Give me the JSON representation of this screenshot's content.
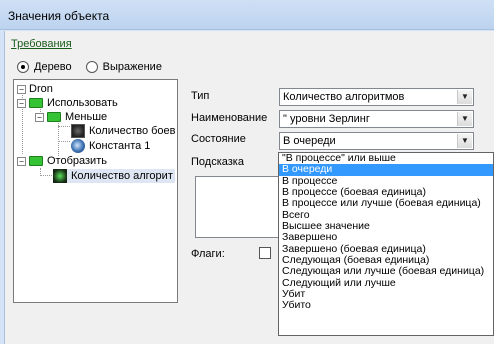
{
  "window": {
    "title": "Значения объекта"
  },
  "tab": {
    "label": "Требования"
  },
  "view_mode": {
    "tree_label": "Дерево",
    "expression_label": "Выражение",
    "selected": "tree"
  },
  "tree": {
    "nodes": [
      {
        "label": "Dron",
        "toggle": "−"
      },
      {
        "label": "Использовать",
        "toggle": "−"
      },
      {
        "label": "Меньше",
        "toggle": "−"
      },
      {
        "label": "Количество боев"
      },
      {
        "label": "Константа 1"
      },
      {
        "label": "Отобразить",
        "toggle": "−"
      },
      {
        "label": "Количество алгорит"
      }
    ]
  },
  "form": {
    "type_label": "Тип",
    "type_value": "Количество алгоритмов",
    "name_label": "Наименование",
    "name_value": "\" уровни Зерлинг",
    "state_label": "Состояние",
    "state_value": "В очереди",
    "hint_label": "Подсказка",
    "flags_label": "Флаги:"
  },
  "state_dropdown": {
    "options": [
      "\"В процессе\" или выше",
      "В очереди",
      "В процессе",
      "В процессе (боевая единица)",
      "В процессе или лучше (боевая единица)",
      "Всего",
      "Высшее значение",
      "Завершено",
      "Завершено (боевая единица)",
      "Следующая (боевая единица)",
      "Следующая или лучше (боевая единица)",
      "Следующий или лучше",
      "Убит",
      "Убито"
    ],
    "highlighted_index": 1
  },
  "colors": {
    "highlight": "#3399ff",
    "link": "#1a5c1a",
    "folder": "#35c235"
  }
}
